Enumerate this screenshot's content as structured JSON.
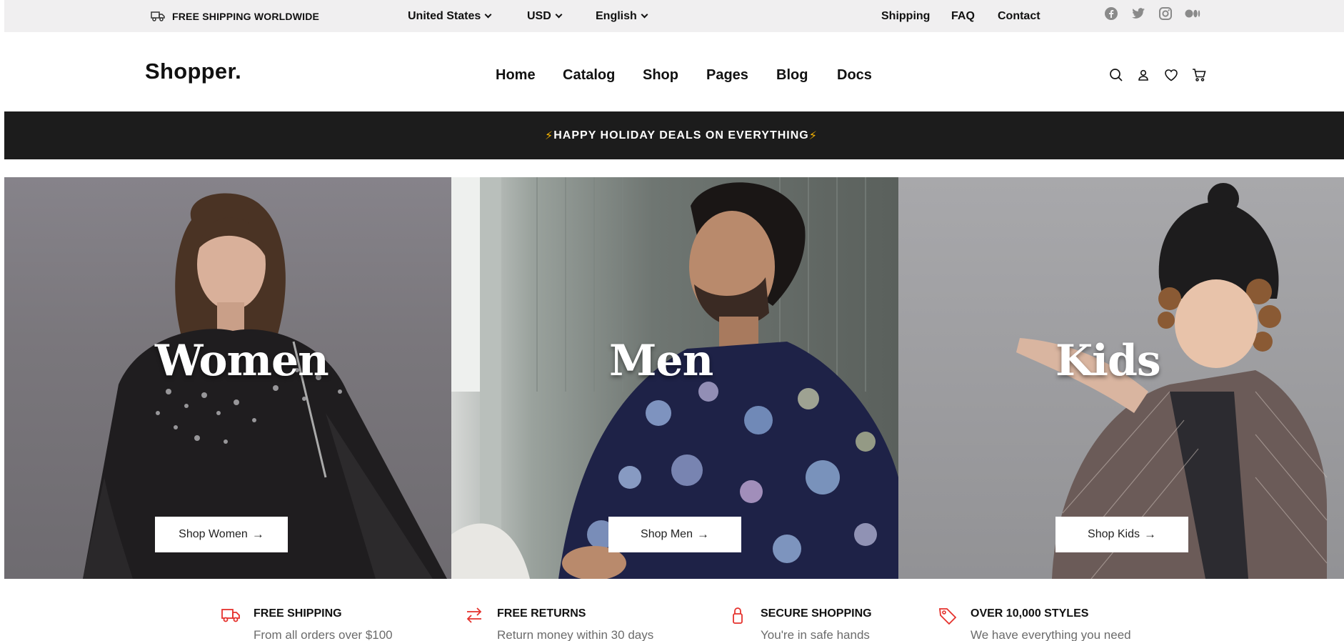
{
  "topbar": {
    "shipping_text": "FREE SHIPPING WORLDWIDE",
    "country": "United States",
    "currency": "USD",
    "language": "English",
    "links": [
      "Shipping",
      "FAQ",
      "Contact"
    ],
    "social_icons": [
      "facebook-icon",
      "twitter-icon",
      "instagram-icon",
      "medium-icon"
    ]
  },
  "header": {
    "logo": "Shopper.",
    "nav": [
      "Home",
      "Catalog",
      "Shop",
      "Pages",
      "Blog",
      "Docs"
    ],
    "icons": [
      "search-icon",
      "user-icon",
      "heart-icon",
      "cart-icon"
    ]
  },
  "promo": {
    "bolt": "⚡",
    "text": "HAPPY HOLIDAY DEALS ON EVERYTHING"
  },
  "hero": {
    "women": {
      "title": "Women",
      "button": "Shop Women"
    },
    "men": {
      "title": "Men",
      "button": "Shop Men"
    },
    "kids": {
      "title": "Kids",
      "button": "Shop Kids"
    },
    "arrow": "→"
  },
  "features": [
    {
      "title": "FREE SHIPPING",
      "subtitle": "From all orders over $100",
      "icon": "truck-icon"
    },
    {
      "title": "FREE RETURNS",
      "subtitle": "Return money within 30 days",
      "icon": "exchange-arrows-icon"
    },
    {
      "title": "SECURE SHOPPING",
      "subtitle": "You're in safe hands",
      "icon": "lock-icon"
    },
    {
      "title": "OVER 10,000 STYLES",
      "subtitle": "We have everything you need",
      "icon": "tag-icon"
    }
  ],
  "colors": {
    "accent": "#e5322d",
    "promo_bg": "#1c1c1c",
    "topbar_bg": "#f0eff0",
    "bolt": "#f5b301"
  }
}
